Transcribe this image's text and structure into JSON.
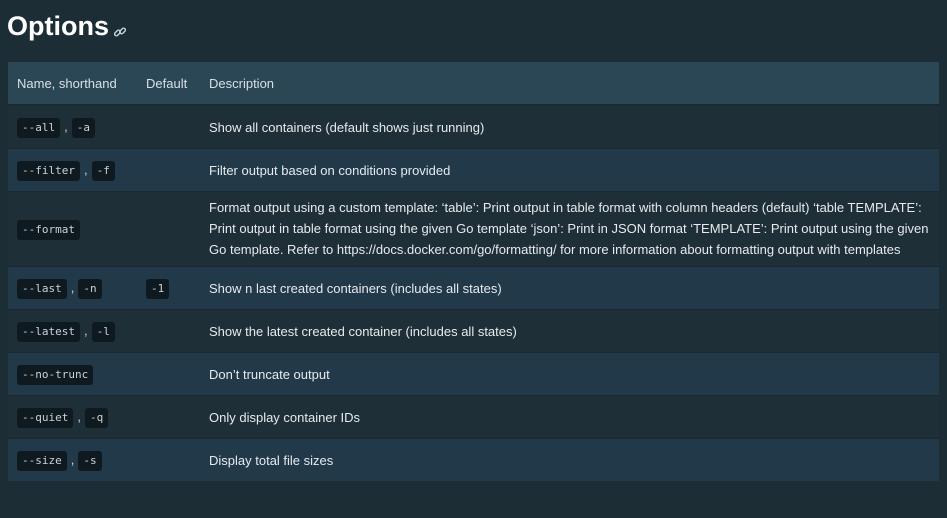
{
  "heading": {
    "title": "Options",
    "anchor_icon": "link-icon"
  },
  "table": {
    "headers": {
      "name": "Name, shorthand",
      "default": "Default",
      "description": "Description"
    },
    "separator": ",",
    "rows": [
      {
        "name": "--all",
        "shorthand": "-a",
        "default": "",
        "description": "Show all containers (default shows just running)"
      },
      {
        "name": "--filter",
        "shorthand": "-f",
        "default": "",
        "description": "Filter output based on conditions provided"
      },
      {
        "name": "--format",
        "shorthand": "",
        "default": "",
        "description": "Format output using a custom template: ‘table’: Print output in table format with column headers (default) ‘table TEMPLATE’: Print output in table format using the given Go template ‘json’: Print in JSON format ‘TEMPLATE’: Print output using the given Go template. Refer to https://docs.docker.com/go/formatting/ for more information about formatting output with templates"
      },
      {
        "name": "--last",
        "shorthand": "-n",
        "default": "-1",
        "description": "Show n last created containers (includes all states)"
      },
      {
        "name": "--latest",
        "shorthand": "-l",
        "default": "",
        "description": "Show the latest created container (includes all states)"
      },
      {
        "name": "--no-trunc",
        "shorthand": "",
        "default": "",
        "description": "Don’t truncate output"
      },
      {
        "name": "--quiet",
        "shorthand": "-q",
        "default": "",
        "description": "Only display container IDs"
      },
      {
        "name": "--size",
        "shorthand": "-s",
        "default": "",
        "description": "Display total file sizes"
      }
    ]
  }
}
